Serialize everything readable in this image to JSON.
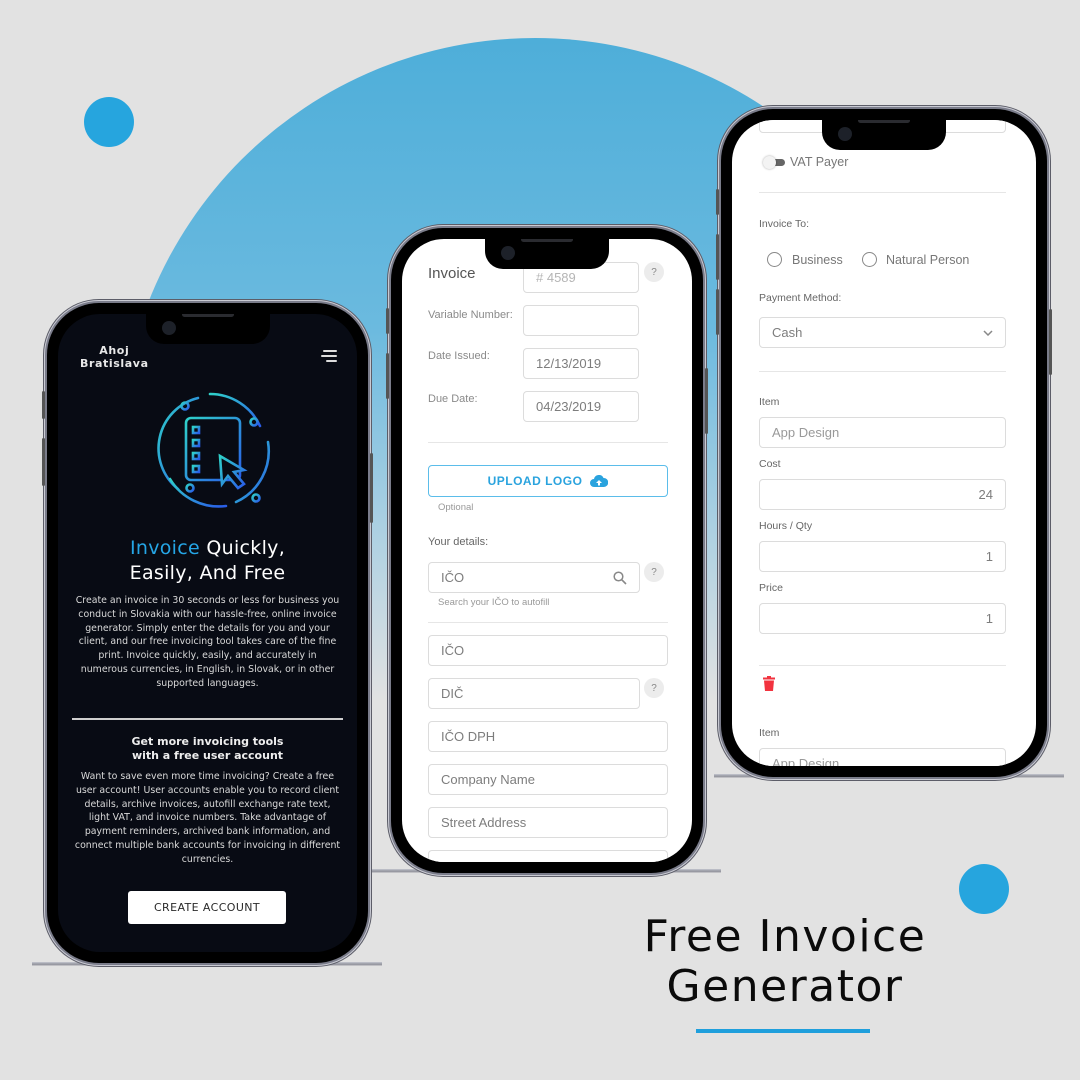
{
  "colors": {
    "accent": "#26a5de",
    "circle": "#4eaed9",
    "dark_screen": "#080b14",
    "danger": "#f2333f"
  },
  "headline": {
    "line1": "Free Invoice",
    "line2": "Generator"
  },
  "phone_landing": {
    "brand_line1": "Ahoj",
    "brand_line2": "Bratislava",
    "menu_icon": "hamburger-icon",
    "hero_icon": "invoice-checklist-icon",
    "title_accent": "Invoice",
    "title_rest_line1": "Quickly,",
    "title_line2": "Easily, And Free",
    "intro": "Create an invoice in 30 seconds or less for business you conduct in Slovakia with our hassle-free, online invoice generator. Simply enter the details for you and your client, and our free invoicing tool takes care of the fine print. Invoice quickly, easily, and accurately in numerous currencies, in English, in Slovak, or in other supported languages.",
    "subtitle_line1": "Get more invoicing tools",
    "subtitle_line2": "with a free user account",
    "account_text": "Want to save even more time invoicing? Create a free user account! User accounts enable you to record client details, archive invoices, autofill exchange rate text, light VAT, and invoice numbers. Take advantage of payment reminders, archived bank information, and connect multiple bank accounts for invoicing in different currencies.",
    "cta_label": "CREATE ACCOUNT"
  },
  "phone_invoice_form": {
    "title": "Invoice",
    "invoice_number_placeholder": "# 4589",
    "help_label": "?",
    "variable_number_label": "Variable Number:",
    "variable_number_value": "",
    "date_issued_label": "Date Issued:",
    "date_issued_value": "12/13/2019",
    "due_date_label": "Due Date:",
    "due_date_value": "04/23/2019",
    "upload_logo_label": "UPLOAD LOGO",
    "upload_hint": "Optional",
    "your_details_label": "Your details:",
    "ico_search_placeholder": "IČO",
    "ico_search_hint": "Search your IČO to autofill",
    "fields": {
      "ico": "IČO",
      "dic": "DIČ",
      "ico_dph": "IČO DPH",
      "company_name": "Company Name",
      "street_address": "Street Address"
    }
  },
  "phone_items": {
    "vat_payer_label": "VAT Payer",
    "vat_payer_on": false,
    "invoice_to_label": "Invoice To:",
    "invoice_to_options": [
      "Business",
      "Natural Person"
    ],
    "payment_method_label": "Payment Method:",
    "payment_method_value": "Cash",
    "items": [
      {
        "item_label": "Item",
        "item_placeholder": "App Design",
        "cost_label": "Cost",
        "cost_value": "24",
        "qty_label": "Hours / Qty",
        "qty_value": "1",
        "price_label": "Price",
        "price_value": "1"
      },
      {
        "item_label": "Item",
        "item_placeholder": "App Design"
      }
    ]
  }
}
